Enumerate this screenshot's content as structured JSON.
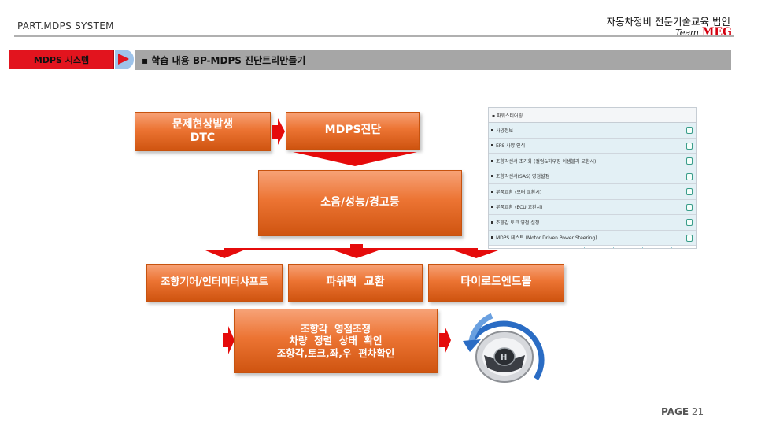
{
  "header": {
    "left": "PART.MDPS SYSTEM",
    "right_line1": "자동차정비 전문기술교육 법인",
    "team_label": "Team",
    "team_brand": "MEG"
  },
  "section": {
    "tag": "MDPS 시스템",
    "topic": "▪ 학습 내용 BP-MDPS 진단트리만들기"
  },
  "flow": {
    "box_symptom": "문제현상발생\nDTC",
    "box_diag": "MDPS진단",
    "box_noise": "소음/성능/경고등",
    "box_gear": "조향기어/인터미터샤프트",
    "box_powerpack": "파워팩  교환",
    "box_tierod": "타이로드엔드볼",
    "box_check": "조향각  영점조정\n차량  정렬  상태  확인\n조향각,토크,좌,우  편차확인",
    "wheel_label": "좌회전"
  },
  "panel": {
    "title": "▪ 파워스티어링",
    "items": [
      "사양정보",
      "EPS 사양 인식",
      "조향각센서 초기화 (컬럼&하우징 어셈블리 교환시)",
      "조향각센서(SAS) 영점설정",
      "부품교환 (모터 교환시)",
      "부품교환 (ECU 교환시)",
      "조향감 토크 영점 설정",
      "MDPS 테스트 (Motor Driven Power Steering)"
    ]
  },
  "footer": {
    "page_label": "PAGE",
    "page_number": "21"
  },
  "colors": {
    "accent_red": "#e2141e",
    "orange": "#ec7433",
    "topic_gray": "#a6a6a6",
    "wheel_arc": "#2a6cc4"
  }
}
